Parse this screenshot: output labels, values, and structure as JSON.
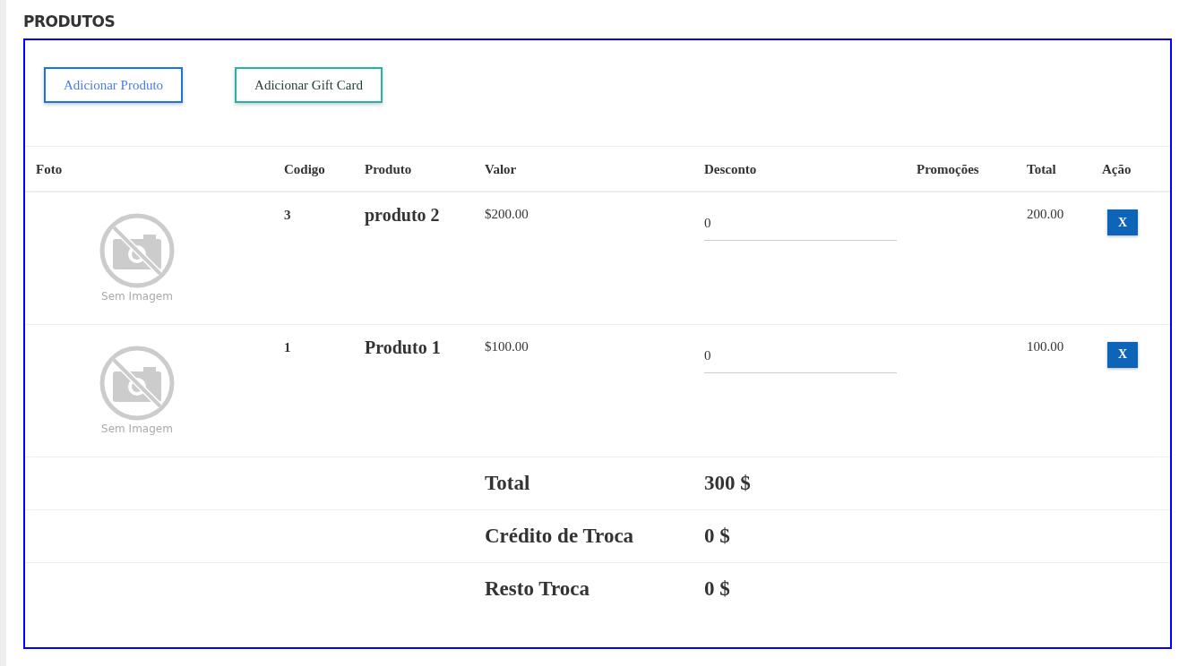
{
  "title": "PRODUTOS",
  "buttons": [
    {
      "label": "Adicionar Produto",
      "kind": "primary"
    },
    {
      "label": "Adicionar Gift Card",
      "kind": "secondary"
    }
  ],
  "table": {
    "columns": [
      "Foto",
      "Codigo",
      "Produto",
      "Valor",
      "Desconto",
      "Promoções",
      "Total",
      "Ação"
    ],
    "rows": [
      {
        "photo_caption": "Sem Imagem",
        "code": "3",
        "product": "produto 2",
        "price": "$200.00",
        "discount": "0",
        "total": "200.00",
        "action": "X"
      },
      {
        "photo_caption": "Sem Imagem",
        "code": "1",
        "product": "Produto 1",
        "price": "$100.00",
        "discount": "0",
        "total": "100.00",
        "action": "X"
      }
    ]
  },
  "summary": [
    {
      "label": "Total",
      "value": "300 $"
    },
    {
      "label": "Crédito de Troca",
      "value": "0 $"
    },
    {
      "label": "Resto Troca",
      "value": "0 $"
    }
  ]
}
